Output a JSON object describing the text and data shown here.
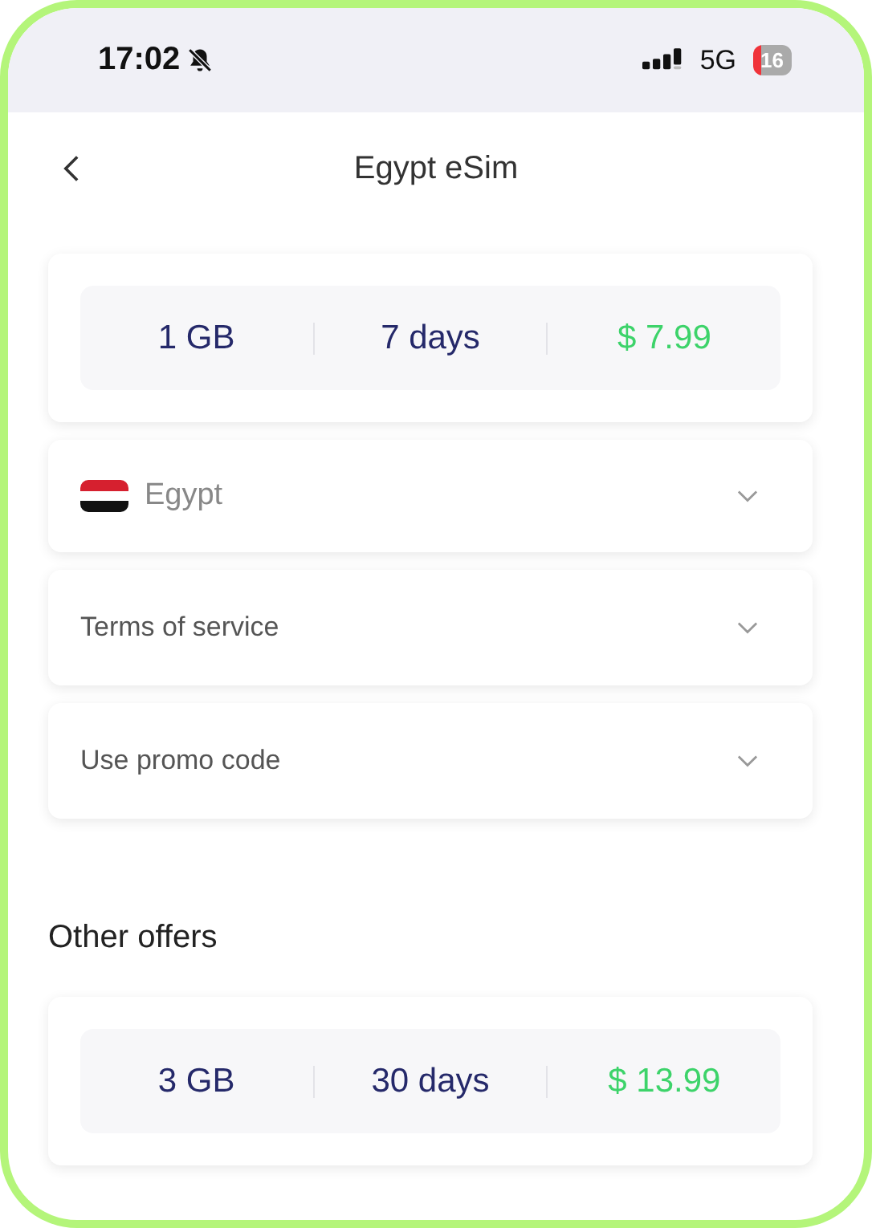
{
  "status_bar": {
    "time": "17:02",
    "network": "5G",
    "battery": "16"
  },
  "header": {
    "title": "Egypt eSim"
  },
  "plan": {
    "data": "1 GB",
    "duration": "7 days",
    "price": "$ 7.99"
  },
  "sections": [
    {
      "kind": "country",
      "label": "Egypt"
    },
    {
      "kind": "plain",
      "label": "Terms of service"
    },
    {
      "kind": "plain",
      "label": "Use promo code"
    }
  ],
  "other_offers": {
    "title": "Other offers",
    "offers": [
      {
        "data": "3 GB",
        "duration": "30 days",
        "price": "$ 13.99"
      }
    ]
  }
}
